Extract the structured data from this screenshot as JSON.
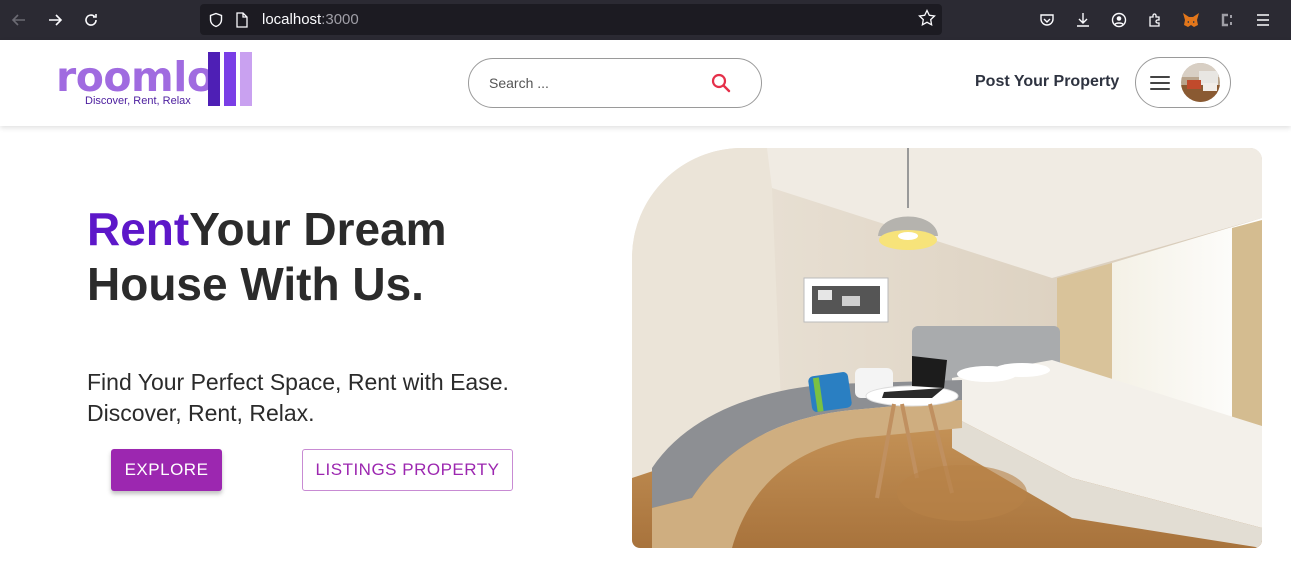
{
  "browser": {
    "url_host": "localhost",
    "url_port": ":3000"
  },
  "header": {
    "logo_word": "roomlo",
    "logo_tagline": "Discover, Rent, Relax",
    "search_placeholder": "Search ...",
    "post_property_label": "Post Your Property"
  },
  "hero": {
    "title_accent": "Rent",
    "title_rest": "Your Dream House With Us.",
    "subtitle_line1": "Find Your Perfect Space, Rent with Ease.",
    "subtitle_line2": "Discover, Rent, Relax.",
    "explore_label": "EXPLORE",
    "listings_label": "LISTINGS PROPERTY"
  },
  "colors": {
    "brand_purple": "#9c27b0",
    "accent_violet": "#5d17c9",
    "logo_lilac": "#a06be0"
  }
}
